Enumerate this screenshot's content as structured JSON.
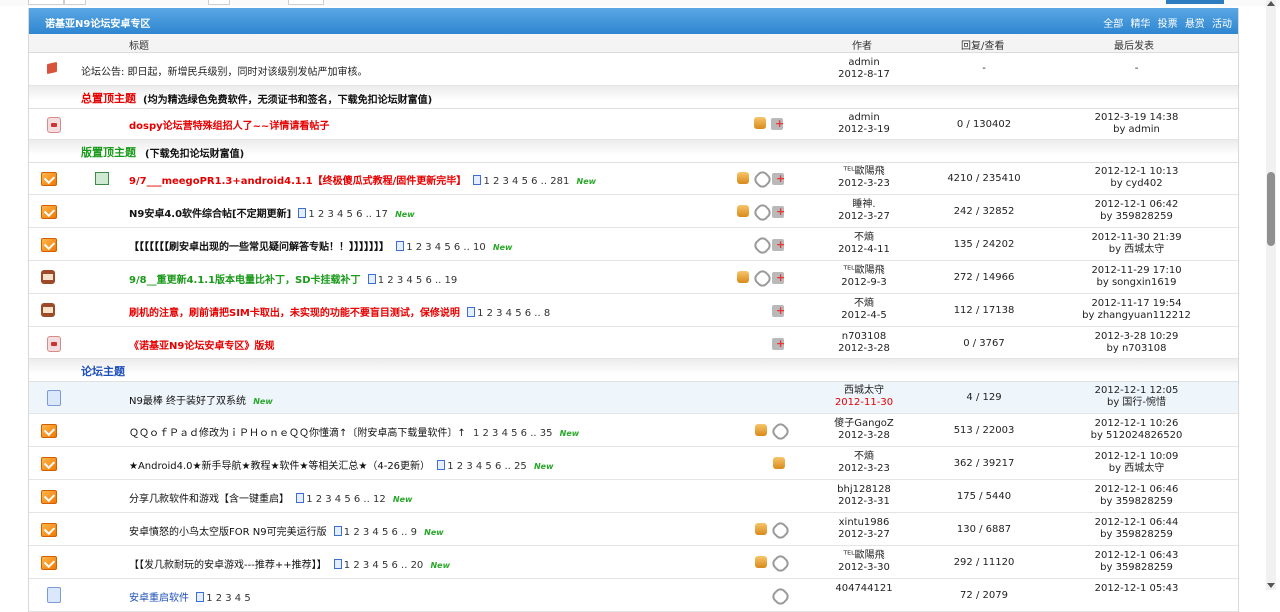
{
  "forum": {
    "title": "诺基亚N9论坛安卓专区",
    "tabs": [
      "全部",
      "精华",
      "投票",
      "悬赏",
      "活动"
    ],
    "columns": {
      "title": "标题",
      "author": "作者",
      "stats": "回复/查看",
      "last": "最后发表"
    }
  },
  "announcement": {
    "text": "论坛公告: 即日起，新增民兵级别，同时对该级别发帖严加审核。",
    "author": "admin",
    "date": "2012-8-17",
    "stats": "-",
    "last": "-"
  },
  "sections": {
    "global_top": {
      "name": "总置顶主题",
      "sub": "(均为精选绿色免费软件，无须证书和签名，下载免扣论坛财富值)"
    },
    "board_top": {
      "name": "版置顶主题",
      "sub": "(下载免扣论坛财富值)"
    },
    "forum_topics": {
      "name": "论坛主题"
    }
  },
  "global_top_threads": [
    {
      "title": "dospy论坛营特殊组招人了~~详情请看帖子",
      "author": "admin",
      "date": "2012-3-19",
      "stats": "0 / 130402",
      "last_time": "2012-3-19 14:38",
      "last_by": "by admin"
    }
  ],
  "board_top_threads": [
    {
      "title": "9/7___meegoPR1.3+android4.1.1【终极傻瓜式教程/固件更新完毕】",
      "pages": "1 2 3 4 5 6 .. 281",
      "new": "New",
      "author": "ᵀᴱᴸ歐陽飛",
      "date": "2012-3-23",
      "stats": "4210 / 235410",
      "last_time": "2012-12-1 10:13",
      "last_by": "by cyd402"
    },
    {
      "title": "N9安卓4.0软件综合帖[不定期更新]",
      "pages": "1 2 3 4 5 6 .. 17",
      "new": "New",
      "author": "睡神.",
      "date": "2012-3-27",
      "stats": "242 / 32852",
      "last_time": "2012-12-1 06:42",
      "last_by": "by 359828259"
    },
    {
      "title": "【【【【【【【刷安卓出现的一些常见疑问解答专贴！！】】】】】】】",
      "pages": "1 2 3 4 5 6 .. 10",
      "new": "New",
      "author": "不熵",
      "date": "2012-4-11",
      "stats": "135 / 24202",
      "last_time": "2012-11-30 21:39",
      "last_by": "by 西城太守"
    },
    {
      "title": "9/8__重更新4.1.1版本电量比补丁，SD卡挂载补丁",
      "pages": "1 2 3 4 5 6 .. 19",
      "new": "",
      "author": "ᵀᴱᴸ歐陽飛",
      "date": "2012-9-3",
      "stats": "272 / 14966",
      "last_time": "2012-11-29 17:10",
      "last_by": "by songxin1619"
    },
    {
      "title": "刷机的注意，刷前请把SIM卡取出，未实现的功能不要盲目测试，保修说明",
      "pages": "1 2 3 4 5 6 .. 8",
      "new": "",
      "author": "不熵",
      "date": "2012-4-5",
      "stats": "112 / 17138",
      "last_time": "2012-11-17 19:54",
      "last_by": "by zhangyuan112212"
    },
    {
      "title": "《诺基亚N9论坛安卓专区》版规",
      "pages": "",
      "new": "",
      "author": "n703108",
      "date": "2012-3-28",
      "stats": "0 / 3767",
      "last_time": "2012-3-28 10:29",
      "last_by": "by n703108"
    }
  ],
  "forum_threads": [
    {
      "title": "N9最棒 终于装好了双系统",
      "pages": "",
      "new": "New",
      "author": "西城太守",
      "date": "2012-11-30",
      "stats": "4 / 129",
      "last_time": "2012-12-1 12:05",
      "last_by": "by 国行-惋惜"
    },
    {
      "title": "ＱＱｏｆＰａｄ修改为ｉＰＨｏｎｅＱＱ你懂滴↑〔附安卓高下载量软件〕↑",
      "pages": "1 2 3 4 5 6 .. 35",
      "new": "New",
      "author": "傻子GangoZ",
      "date": "2012-3-28",
      "stats": "513 / 22003",
      "last_time": "2012-12-1 10:26",
      "last_by": "by 512024826520"
    },
    {
      "title": "★Android4.0★新手导航★教程★软件★等相关汇总★（4-26更新）",
      "pages": "1 2 3 4 5 6 .. 25",
      "new": "New",
      "author": "不熵",
      "date": "2012-3-23",
      "stats": "362 / 39217",
      "last_time": "2012-12-1 10:09",
      "last_by": "by 西城太守"
    },
    {
      "title": "分享几款软件和游戏【含一键重启】",
      "pages": "1 2 3 4 5 6 .. 12",
      "new": "New",
      "author": "bhj128128",
      "date": "2012-3-31",
      "stats": "175 / 5440",
      "last_time": "2012-12-1 06:46",
      "last_by": "by 359828259"
    },
    {
      "title": "安卓憤怒的小鸟太空版FOR N9可完美运行版",
      "pages": "1 2 3 4 5 6 .. 9",
      "new": "New",
      "author": "xintu1986",
      "date": "2012-3-27",
      "stats": "130 / 6887",
      "last_time": "2012-12-1 06:44",
      "last_by": "by 359828259"
    },
    {
      "title": "【【发几款耐玩的安卓游戏---推荐++推荐】】",
      "pages": "1 2 3 4 5 6 .. 20",
      "new": "New",
      "author": "ᵀᴱᴸ歐陽飛",
      "date": "2012-3-30",
      "stats": "292 / 11120",
      "last_time": "2012-12-1 06:43",
      "last_by": "by 359828259"
    },
    {
      "title": "安卓重启软件",
      "pages": "1 2 3 4 5",
      "new": "",
      "author": "404744121",
      "date": "",
      "stats": "72 / 2079",
      "last_time": "2012-12-1 05:43",
      "last_by": ""
    }
  ],
  "icons": [
    "fire-icon",
    "lock-icon",
    "note-icon",
    "envelope-icon",
    "flag-icon",
    "thumb-up-icon",
    "attachment-icon",
    "reply-plus-icon",
    "page-icon"
  ],
  "colors": {
    "header_blue": "#2f86d0",
    "sticky_red": "#e60000",
    "sticky_green": "#1a9a1a",
    "link_blue": "#1d4fb8"
  }
}
